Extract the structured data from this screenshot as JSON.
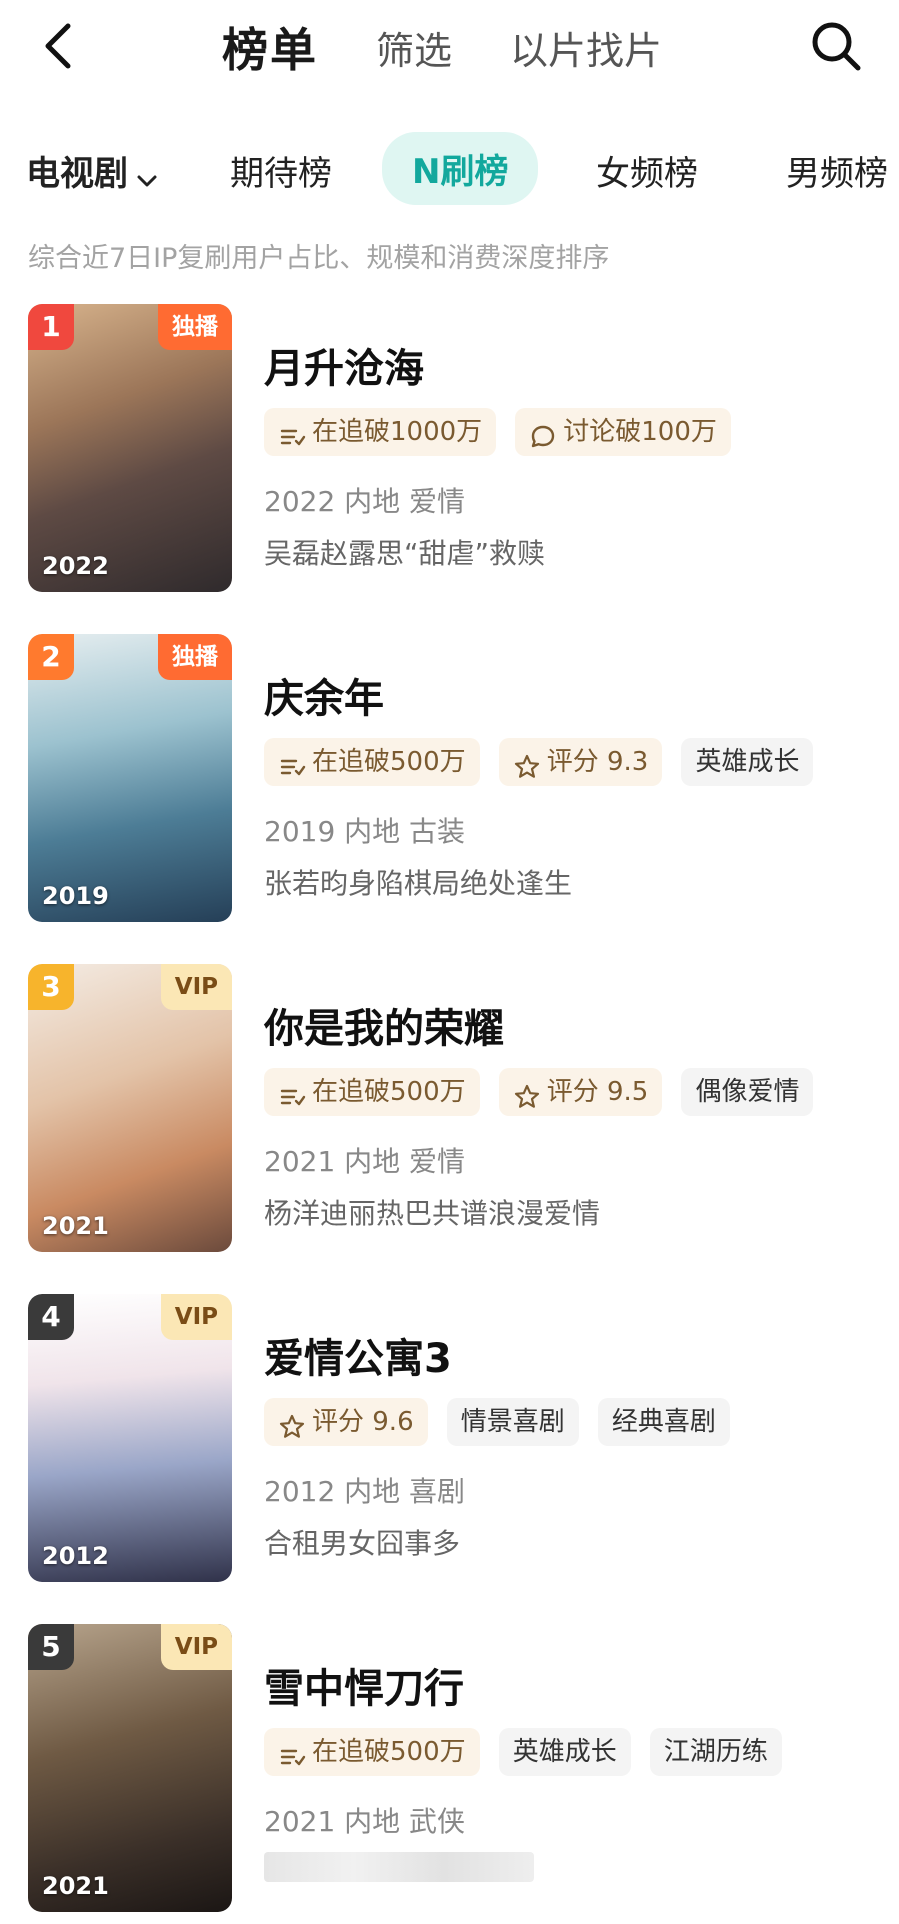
{
  "header": {
    "title": "榜单",
    "nav": [
      "筛选",
      "以片找片"
    ]
  },
  "tabs": {
    "category": "电视剧",
    "items": [
      "期待榜",
      "N刷榜",
      "女频榜",
      "男频榜"
    ],
    "active": "N刷榜"
  },
  "description": "综合近7日IP复刷用户占比、规模和消费深度排序",
  "list": [
    {
      "rank": "1",
      "badge": "独播",
      "year": "2022",
      "title": "月升沧海",
      "tags": [
        "在追破1000万",
        "讨论破100万"
      ],
      "meta": "2022 内地 爱情",
      "blurb": "吴磊赵露思“甜虐”救赎"
    },
    {
      "rank": "2",
      "badge": "独播",
      "year": "2019",
      "title": "庆余年",
      "tags": [
        "在追破500万",
        "评分 9.3",
        "英雄成长"
      ],
      "meta": "2019 内地 古装",
      "blurb": "张若昀身陷棋局绝处逢生"
    },
    {
      "rank": "3",
      "badge": "VIP",
      "year": "2021",
      "title": "你是我的荣耀",
      "tags": [
        "在追破500万",
        "评分 9.5",
        "偶像爱情"
      ],
      "meta": "2021 内地 爱情",
      "blurb": "杨洋迪丽热巴共谱浪漫爱情"
    },
    {
      "rank": "4",
      "badge": "VIP",
      "year": "2012",
      "title": "爱情公寓3",
      "tags": [
        "评分 9.6",
        "情景喜剧",
        "经典喜剧"
      ],
      "meta": "2012 内地 喜剧",
      "blurb": "合租男女囧事多"
    },
    {
      "rank": "5",
      "badge": "VIP",
      "year": "2021",
      "title": "雪中悍刀行",
      "tags": [
        "在追破500万",
        "英雄成长",
        "江湖历练"
      ],
      "meta": "2021 内地 武侠",
      "blurb": ""
    }
  ],
  "colors": {
    "accent": "#12a89d",
    "rank1": "#f0483e",
    "rank2": "#ff7a2e",
    "rank3": "#f7b42c",
    "rank_other": "#3a3a3a",
    "exclusive": "#ff6b32"
  },
  "icons": [
    "back-arrow-icon",
    "search-icon",
    "chevron-down-icon",
    "follow-list-icon",
    "comment-icon",
    "star-icon"
  ]
}
